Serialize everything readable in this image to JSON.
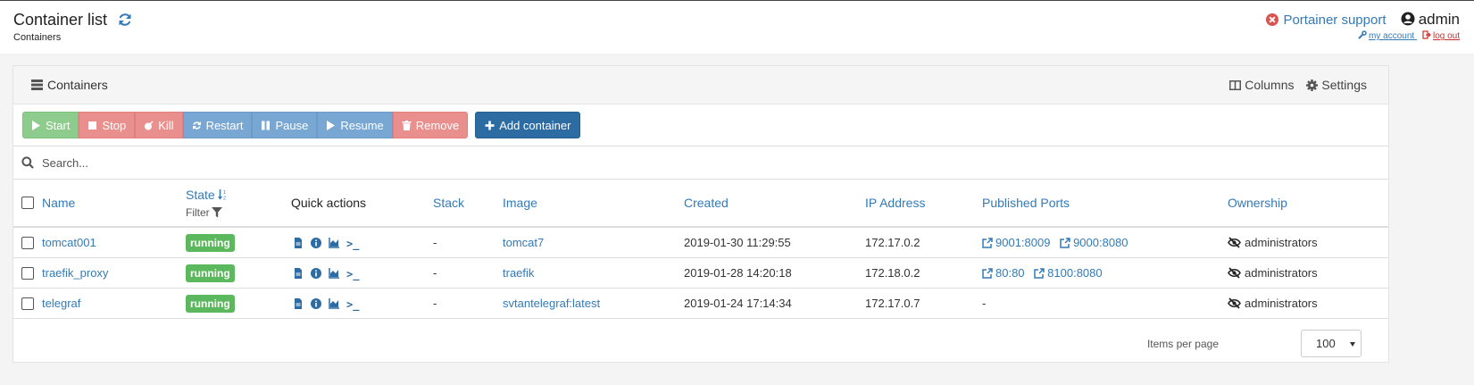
{
  "header": {
    "title": "Container list",
    "breadcrumb": "Containers",
    "support_label": "Portainer support",
    "user_name": "admin",
    "my_account": "my account",
    "logout": "log out"
  },
  "widget": {
    "title": "Containers",
    "columns_label": "Columns",
    "settings_label": "Settings"
  },
  "actions": {
    "start": "Start",
    "stop": "Stop",
    "kill": "Kill",
    "restart": "Restart",
    "pause": "Pause",
    "resume": "Resume",
    "remove": "Remove",
    "add": "Add container"
  },
  "search": {
    "placeholder": "Search..."
  },
  "columns": {
    "name": "Name",
    "state": "State",
    "filter": "Filter",
    "quick_actions": "Quick actions",
    "stack": "Stack",
    "image": "Image",
    "created": "Created",
    "ip": "IP Address",
    "ports": "Published Ports",
    "ownership": "Ownership"
  },
  "rows": [
    {
      "name": "tomcat001",
      "state": "running",
      "stack": "-",
      "image": "tomcat7",
      "created": "2019-01-30 11:29:55",
      "ip": "172.17.0.2",
      "ports": [
        "9001:8009",
        "9000:8080"
      ],
      "ports_empty": "",
      "ownership": "administrators"
    },
    {
      "name": "traefik_proxy",
      "state": "running",
      "stack": "-",
      "image": "traefik",
      "created": "2019-01-28 14:20:18",
      "ip": "172.18.0.2",
      "ports": [
        "80:80",
        "8100:8080"
      ],
      "ports_empty": "",
      "ownership": "administrators"
    },
    {
      "name": "telegraf",
      "state": "running",
      "stack": "-",
      "image": "svtantelegraf:latest",
      "created": "2019-01-24 17:14:34",
      "ip": "172.17.0.7",
      "ports": [],
      "ports_empty": "-",
      "ownership": "administrators"
    }
  ],
  "pagination": {
    "label": "Items per page",
    "value": "100"
  },
  "icons": {
    "refresh": "refresh-icon",
    "support": "times-circle-icon",
    "user": "user-icon",
    "account": "wrench-icon",
    "logout": "sign-out-icon",
    "list": "list-icon",
    "columns": "columns-icon",
    "settings": "gear-icon",
    "quick_actions": [
      "file-icon",
      "info-icon",
      "area-chart-icon",
      "terminal-icon"
    ],
    "ports": "external-link-icon",
    "ownership": "eye-slash-icon"
  },
  "colors": {
    "link": "#337ab7",
    "success": "#5cb85c",
    "danger": "#d9534f",
    "primary": "#2d6ca2"
  }
}
